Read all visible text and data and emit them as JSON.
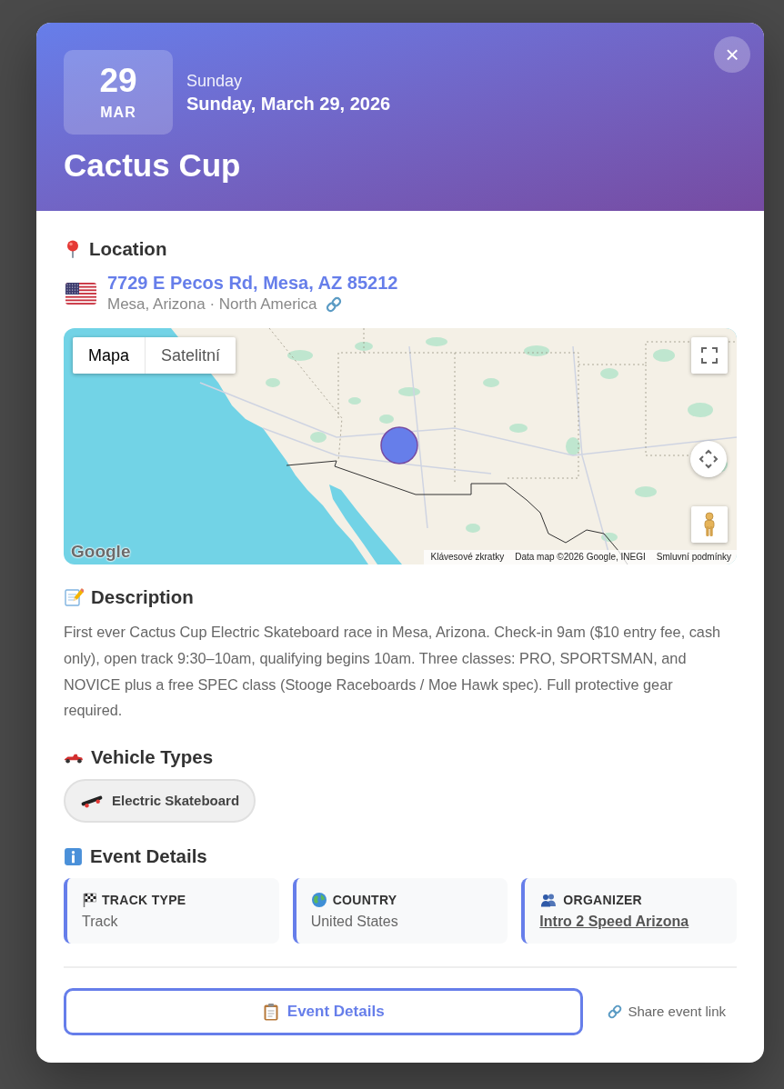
{
  "header": {
    "day": "29",
    "month": "MAR",
    "weekday": "Sunday",
    "full_date": "Sunday, March 29, 2026",
    "title": "Cactus Cup",
    "close": "×"
  },
  "location": {
    "heading": "Location",
    "address": "7729 E Pecos Rd, Mesa, AZ 85212",
    "region": "Mesa, Arizona · North America"
  },
  "map": {
    "tabs": [
      {
        "label": "Mapa",
        "selected": true
      },
      {
        "label": "Satelitní",
        "selected": false
      }
    ],
    "logo": "Google",
    "attribution": [
      "Klávesové zkratky",
      "Data map ©2026 Google, INEGI",
      "Smluvní podmínky"
    ]
  },
  "description": {
    "heading": "Description",
    "text": "First ever Cactus Cup Electric Skateboard race in Mesa, Arizona. Check-in 9am ($10 entry fee, cash only), open track 9:30–10am, qualifying begins 10am. Three classes: PRO, SPORTSMAN, and NOVICE plus a free SPEC class (Stooge Raceboards / Moe Hawk spec). Full protective gear required."
  },
  "vehicle_types": {
    "heading": "Vehicle Types",
    "items": [
      {
        "kind": "skateboard",
        "label": "Electric Skateboard"
      }
    ]
  },
  "event_details": {
    "heading": "Event Details",
    "cards": [
      {
        "kind": "track",
        "label": "TRACK TYPE",
        "value": "Track",
        "link": false
      },
      {
        "kind": "country",
        "label": "COUNTRY",
        "value": "United States",
        "link": false
      },
      {
        "kind": "organizer",
        "label": "ORGANIZER",
        "value": "Intro 2 Speed Arizona",
        "link": true
      }
    ]
  },
  "actions": {
    "primary": "Event Details",
    "share": "Share event link"
  }
}
